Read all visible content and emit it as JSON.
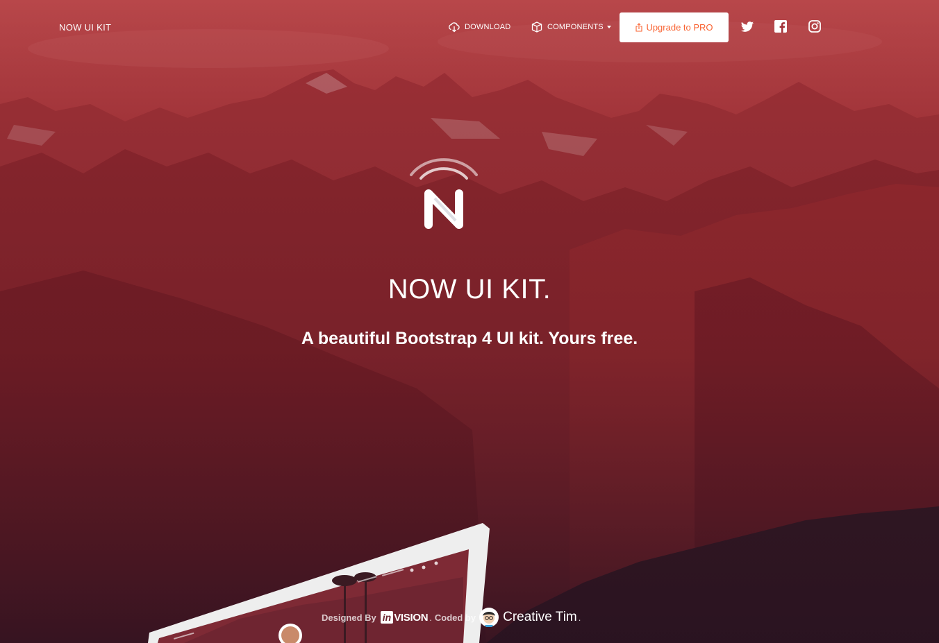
{
  "navbar": {
    "brand": "NOW UI KIT",
    "download_label": "DOWNLOAD",
    "components_label": "COMPONENTS",
    "pro_button_label": "Upgrade to PRO"
  },
  "hero": {
    "title": "NOW UI KIT.",
    "subtitle": "A beautiful Bootstrap 4 UI kit. Yours free."
  },
  "credits": {
    "designed_by": "Designed By",
    "invision_in": "in",
    "invision_rest": "VISION",
    "separator": ".",
    "coded_by": "Coded by",
    "author": "Creative Tim",
    "end_dot": "."
  },
  "icons": {
    "download": "cloud-download-icon",
    "components": "box-icon",
    "pro": "share-icon",
    "twitter": "twitter-icon",
    "facebook": "facebook-icon",
    "instagram": "instagram-icon"
  },
  "colors": {
    "accent": "#f96332",
    "hero_overlay_top": "#b23a3f",
    "hero_overlay_bottom": "#3e1520"
  }
}
